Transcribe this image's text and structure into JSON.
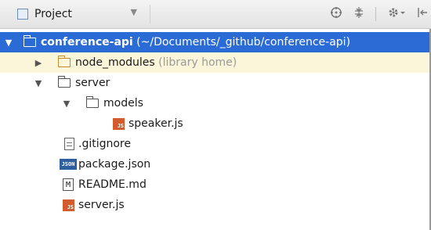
{
  "toolbar": {
    "view_label": "Project",
    "icons": [
      "target-icon",
      "collapse-icon",
      "settings-icon",
      "hide-icon"
    ]
  },
  "tree": {
    "root": {
      "name": "conference-api",
      "path": "(~/Documents/_github/conference-api)"
    },
    "node_modules": {
      "name": "node_modules",
      "hint": "(library home)"
    },
    "server": {
      "name": "server"
    },
    "models": {
      "name": "models"
    },
    "speaker": {
      "name": "speaker.js"
    },
    "gitignore": {
      "name": ".gitignore"
    },
    "package": {
      "name": "package.json"
    },
    "readme": {
      "name": "README.md"
    },
    "serverjs": {
      "name": "server.js"
    }
  },
  "colors": {
    "selection": "#2a6bd6",
    "excluded_bg": "#fbf5d9",
    "js": "#d35b2e"
  }
}
